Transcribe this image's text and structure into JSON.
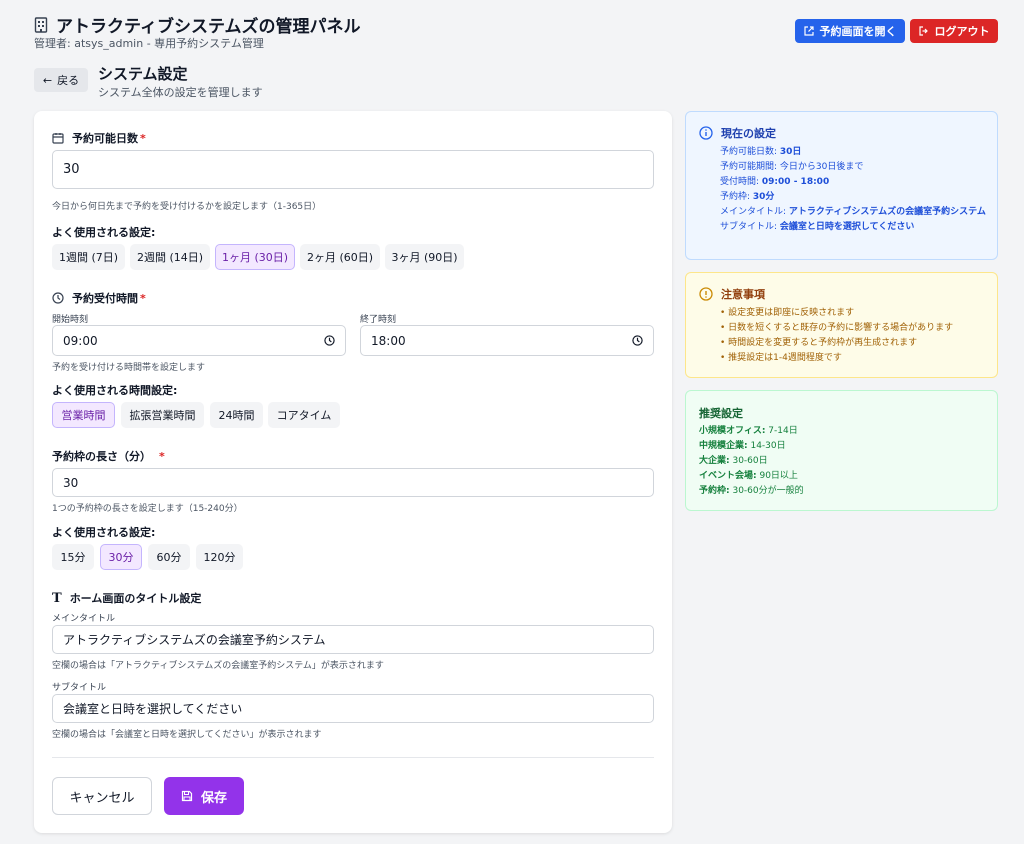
{
  "header": {
    "title": "アトラクティブシステムズの管理パネル",
    "subtitle": "管理者: atsys_admin - 専用予約システム管理",
    "open_booking": "予約画面を開く",
    "logout": "ログアウト"
  },
  "page": {
    "back": "戻る",
    "title": "システム設定",
    "subtitle": "システム全体の設定を管理します"
  },
  "form": {
    "booking_days": {
      "label": "予約可能日数",
      "required": "*",
      "value": "30",
      "help": "今日から何日先まで予約を受け付けるかを設定します（1-365日）",
      "presets_title": "よく使用される設定:",
      "presets": [
        "1週間 (7日)",
        "2週間 (14日)",
        "1ヶ月 (30日)",
        "2ヶ月 (60日)",
        "3ヶ月 (90日)"
      ]
    },
    "hours": {
      "label": "予約受付時間",
      "required": "*",
      "start_label": "開始時刻",
      "start_value": "09:00",
      "end_label": "終了時刻",
      "end_value": "18:00",
      "help": "予約を受け付ける時間帯を設定します",
      "presets_title": "よく使用される時間設定:",
      "presets": [
        "営業時間",
        "拡張営業時間",
        "24時間",
        "コアタイム"
      ]
    },
    "slot": {
      "label": "予約枠の長さ（分）",
      "required": "*",
      "value": "30",
      "help": "1つの予約枠の長さを設定します（15-240分）",
      "presets_title": "よく使用される設定:",
      "presets": [
        "15分",
        "30分",
        "60分",
        "120分"
      ]
    },
    "title_settings": {
      "label": "ホーム画面のタイトル設定",
      "main_label": "メインタイトル",
      "main_value": "アトラクティブシステムズの会議室予約システム",
      "main_help": "空欄の場合は「アトラクティブシステムズの会議室予約システム」が表示されます",
      "sub_label": "サブタイトル",
      "sub_value": "会議室と日時を選択してください",
      "sub_help": "空欄の場合は「会議室と日時を選択してください」が表示されます"
    },
    "cancel": "キャンセル",
    "save": "保存"
  },
  "current": {
    "title": "現在の設定",
    "lines": [
      {
        "k": "予約可能日数: ",
        "v": "30日"
      },
      {
        "k": "予約可能期間: 今日から30日後まで",
        "v": ""
      },
      {
        "k": "受付時間: ",
        "v": "09:00 - 18:00"
      },
      {
        "k": "予約枠: ",
        "v": "30分"
      },
      {
        "k": "メインタイトル: ",
        "v": "アトラクティブシステムズの会議室予約システム"
      },
      {
        "k": "サブタイトル: ",
        "v": "会議室と日時を選択してください"
      }
    ]
  },
  "notes": {
    "title": "注意事項",
    "items": [
      "• 設定変更は即座に反映されます",
      "• 日数を短くすると既存の予約に影響する場合があります",
      "• 時間設定を変更すると予約枠が再生成されます",
      "• 推奨設定は1-4週間程度です"
    ]
  },
  "recommend": {
    "title": "推奨設定",
    "items": [
      {
        "k": "小規模オフィス:",
        "v": " 7-14日"
      },
      {
        "k": "中規模企業:",
        "v": " 14-30日"
      },
      {
        "k": "大企業:",
        "v": " 30-60日"
      },
      {
        "k": "イベント会場:",
        "v": " 90日以上"
      },
      {
        "k": "予約枠:",
        "v": " 30-60分が一般的"
      }
    ]
  }
}
